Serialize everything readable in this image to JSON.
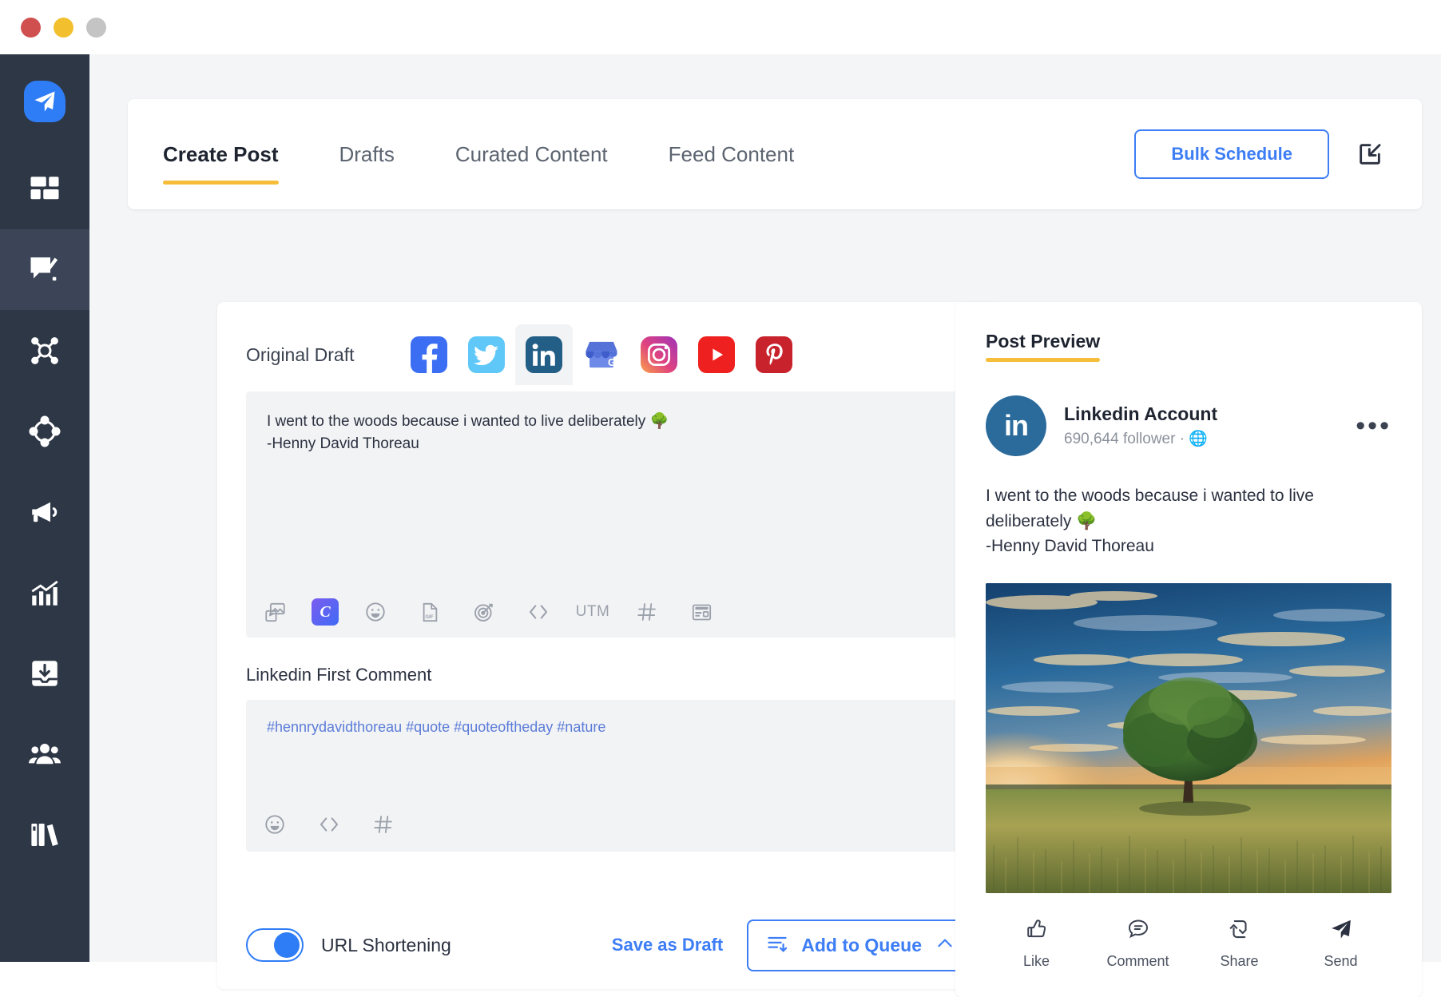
{
  "window": {
    "traffic_lights": [
      "close",
      "minimize",
      "maximize"
    ]
  },
  "sidebar": {
    "logo_icon": "paper-plane-icon",
    "items": [
      {
        "icon": "dashboard-grid-icon",
        "name": "dashboard",
        "active": false
      },
      {
        "icon": "compose-post-icon",
        "name": "publish",
        "active": true
      },
      {
        "icon": "network-engage-icon",
        "name": "engage",
        "active": false
      },
      {
        "icon": "nodes-circle-icon",
        "name": "collaborate",
        "active": false
      },
      {
        "icon": "megaphone-icon",
        "name": "advertise",
        "active": false
      },
      {
        "icon": "analytics-chart-icon",
        "name": "analytics",
        "active": false
      },
      {
        "icon": "inbox-download-icon",
        "name": "inbox",
        "active": false
      },
      {
        "icon": "team-people-icon",
        "name": "team",
        "active": false
      },
      {
        "icon": "library-books-icon",
        "name": "library",
        "active": false
      }
    ]
  },
  "header": {
    "tabs": [
      {
        "label": "Create Post",
        "active": true
      },
      {
        "label": "Drafts",
        "active": false
      },
      {
        "label": "Curated Content",
        "active": false
      },
      {
        "label": "Feed Content",
        "active": false
      }
    ],
    "bulk_schedule_label": "Bulk Schedule",
    "import_icon": "import-into-box-icon",
    "accent_blue": "#3d7df5",
    "accent_yellow": "#f5bd3a"
  },
  "composer": {
    "draft_label": "Original Draft",
    "channels": [
      {
        "name": "facebook",
        "selected": false
      },
      {
        "name": "twitter",
        "selected": false
      },
      {
        "name": "linkedin",
        "selected": true
      },
      {
        "name": "google-business",
        "selected": false
      },
      {
        "name": "instagram",
        "selected": false
      },
      {
        "name": "youtube",
        "selected": false
      },
      {
        "name": "pinterest",
        "selected": false
      }
    ],
    "post_text": "I went to the woods because i wanted to live deliberately 🌳\n-Henny David Thoreau",
    "toolbar": [
      {
        "icon": "media-image-icon",
        "label": ""
      },
      {
        "icon": "canva-icon",
        "label": "C"
      },
      {
        "icon": "emoji-icon",
        "label": ""
      },
      {
        "icon": "gif-icon",
        "label": ""
      },
      {
        "icon": "campaign-target-icon",
        "label": ""
      },
      {
        "icon": "code-icon",
        "label": ""
      },
      {
        "icon": "utm-icon",
        "label": "UTM"
      },
      {
        "icon": "hashtag-icon",
        "label": ""
      },
      {
        "icon": "template-card-icon",
        "label": ""
      }
    ],
    "first_comment_label": "Linkedin First Comment",
    "first_comment_text": "#hennrydavidthoreau #quote #quoteoftheday #nature",
    "first_comment_toolbar": [
      {
        "icon": "emoji-icon"
      },
      {
        "icon": "code-icon"
      },
      {
        "icon": "hashtag-icon"
      }
    ],
    "url_shortening_label": "URL Shortening",
    "url_shortening_on": true,
    "save_draft_label": "Save as Draft",
    "add_to_queue_label": "Add to Queue"
  },
  "preview": {
    "title": "Post Preview",
    "avatar_text": "in",
    "account_name": "Linkedin Account",
    "followers": "690,644 follower  · 🌐",
    "more_icon": "ellipsis-icon",
    "post_text": "I went to the woods because i wanted to live deliberately 🌳\n-Henny David Thoreau",
    "image_alt": "sunset-field-tree-photo",
    "actions": [
      {
        "label": "Like",
        "icon": "thumbs-up-icon"
      },
      {
        "label": "Comment",
        "icon": "comment-bubble-icon"
      },
      {
        "label": "Share",
        "icon": "repost-arrows-icon"
      },
      {
        "label": "Send",
        "icon": "send-plane-icon"
      }
    ]
  }
}
